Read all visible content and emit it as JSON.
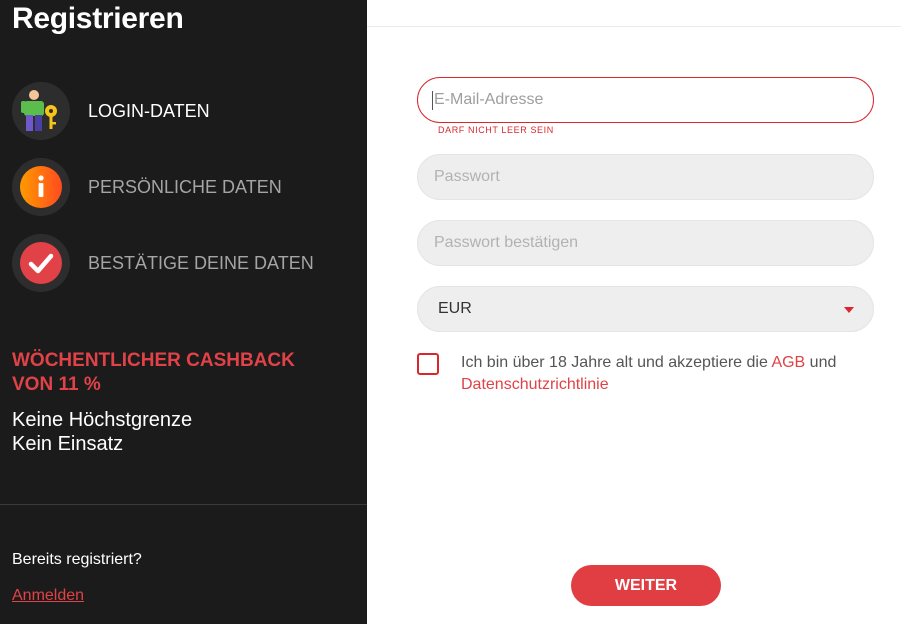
{
  "left_panel": {
    "title": "Registrieren",
    "steps": [
      {
        "label": "LOGIN-DATEN",
        "icon": "person-key-icon",
        "active": true
      },
      {
        "label": "PERSÖNLICHE DATEN",
        "icon": "info-icon",
        "active": false
      },
      {
        "label": "BESTÄTIGE DEINE DATEN",
        "icon": "check-icon",
        "active": false
      }
    ],
    "promo": {
      "headline": "WÖCHENTLICHER CASHBACK VON 11 %",
      "line1": "Keine Höchstgrenze",
      "line2": "Kein Einsatz"
    },
    "already_registered": "Bereits registriert?",
    "login_link": "Anmelden"
  },
  "form": {
    "email_placeholder": "E-Mail-Adresse",
    "email_value": "",
    "email_error": "DARF NICHT LEER SEIN",
    "password_placeholder": "Passwort",
    "password_confirm_placeholder": "Passwort bestätigen",
    "currency_value": "EUR",
    "terms_text_before": "Ich bin über 18 Jahre alt und akzeptiere die ",
    "terms_link_agb": "AGB",
    "terms_text_mid": " und ",
    "terms_link_privacy": "Datenschutzrichtlinie",
    "submit_label": "WEITER"
  },
  "colors": {
    "accent": "#e04247",
    "panel_bg": "#1c1b1b",
    "field_bg": "#eeeeee"
  }
}
